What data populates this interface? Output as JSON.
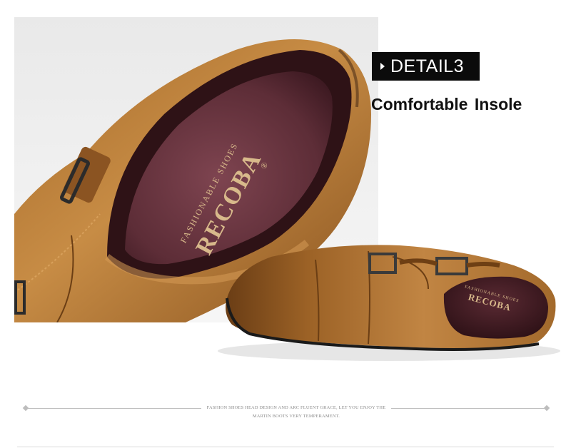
{
  "badge": {
    "label": "DETAIL3"
  },
  "headline": "Comfortable  Insole",
  "insole_brand": {
    "name": "RECOBA",
    "tagline": "FASHIONABLE SHOES",
    "registered_mark": "®"
  },
  "footer": {
    "tagline_line1": "FASHION SHOES HEAD DESIGN AND ARC FLUENT GRACE, LET YOU ENJOY THE",
    "tagline_line2": "MARTIN BOOTS VERY TEMPERAMENT."
  },
  "colors": {
    "leather": "#b07530",
    "leather_dark": "#6e3f14",
    "insole": "#6a3540",
    "brand_gold": "#d8b98b",
    "badge_bg": "#0b0b0b"
  }
}
